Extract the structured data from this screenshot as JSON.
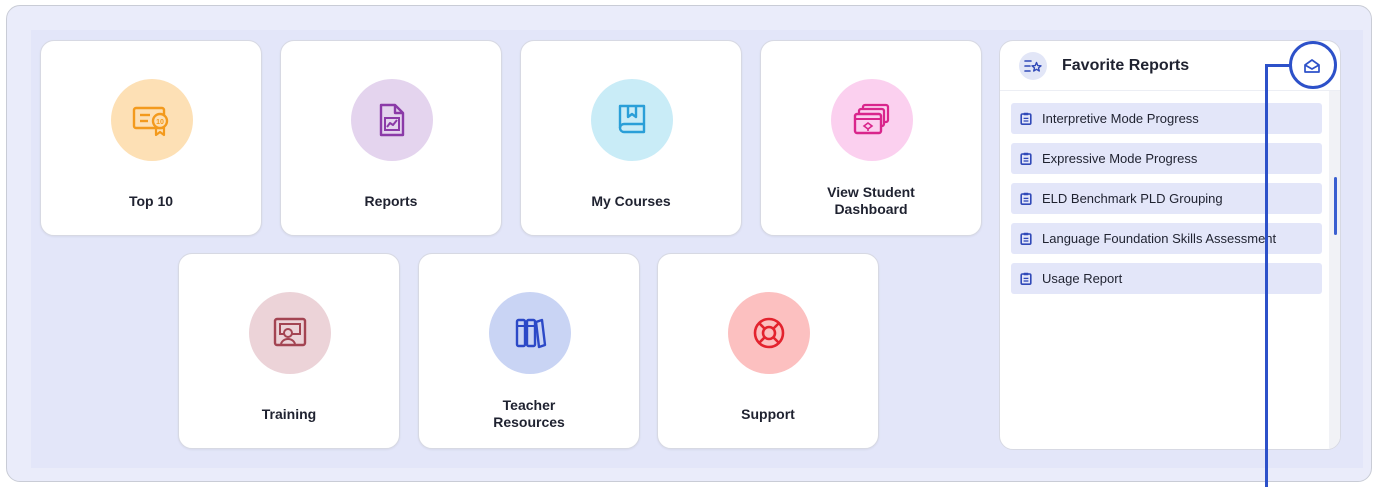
{
  "tiles": [
    {
      "id": "top10",
      "label_lines": [
        "Top 10"
      ],
      "icon": "certificate-icon",
      "bg": "#fde0b5",
      "color": "#f39a1d"
    },
    {
      "id": "reports",
      "label_lines": [
        "Reports"
      ],
      "icon": "report-chart-icon",
      "bg": "#e4d4ee",
      "color": "#8b3aa8"
    },
    {
      "id": "my-courses",
      "label_lines": [
        "My Courses"
      ],
      "icon": "book-icon",
      "bg": "#c9ecf7",
      "color": "#2a9fd8"
    },
    {
      "id": "view-student-dashboard",
      "label_lines": [
        "View Student",
        "Dashboard"
      ],
      "icon": "dashboard-screens-icon",
      "bg": "#fbd0ef",
      "color": "#d9258c"
    },
    {
      "id": "training",
      "label_lines": [
        "Training"
      ],
      "icon": "training-presentation-icon",
      "bg": "#ecd3d8",
      "color": "#a34452"
    },
    {
      "id": "teacher-resources",
      "label_lines": [
        "Teacher",
        "Resources"
      ],
      "icon": "books-icon",
      "bg": "#c9d4f4",
      "color": "#2c49c7"
    },
    {
      "id": "support",
      "label_lines": [
        "Support"
      ],
      "icon": "lifebuoy-icon",
      "bg": "#fcc0c0",
      "color": "#e3232e"
    }
  ],
  "favorites": {
    "title": "Favorite Reports",
    "header_icon": "star-list-icon",
    "action_icon": "mail-open-icon",
    "items": [
      "Interpretive Mode Progress",
      "Expressive Mode Progress",
      "ELD Benchmark PLD Grouping",
      "Language Foundation Skills Assessment",
      "Usage Report"
    ],
    "item_icon": "clipboard-icon"
  },
  "colors": {
    "accent": "#2d51c9",
    "panel_bg": "#e3e6f9",
    "tile_bg": "#ffffff"
  }
}
